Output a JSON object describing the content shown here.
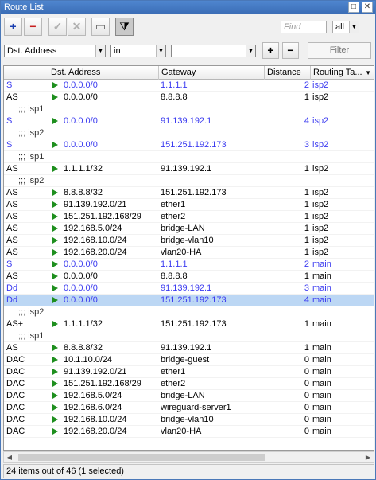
{
  "window": {
    "title": "Route List"
  },
  "toolbar": {
    "add_label": "+",
    "remove_label": "−",
    "enable_label": "✓",
    "disable_label": "✕",
    "comment_label": "▭",
    "filter_label": "⧩",
    "find_placeholder": "Find",
    "scope_value": "all"
  },
  "filter": {
    "field_value": "Dst. Address",
    "operator_value": "in",
    "value": "",
    "add_label": "+",
    "remove_label": "−",
    "button_label": "Filter"
  },
  "table": {
    "columns": [
      "",
      "Dst. Address",
      "Gateway",
      "Distance",
      "Routing Ta..."
    ],
    "rows": [
      {
        "flags": "S",
        "dst": "0.0.0.0/0",
        "gateway": "1.1.1.1",
        "distance": "2",
        "table": "isp2",
        "style": "blue"
      },
      {
        "flags": "AS",
        "dst": "0.0.0.0/0",
        "gateway": "8.8.8.8",
        "distance": "1",
        "table": "isp2",
        "style": "normal"
      },
      {
        "comment": ";;; isp1"
      },
      {
        "flags": "S",
        "dst": "0.0.0.0/0",
        "gateway": "91.139.192.1",
        "distance": "4",
        "table": "isp2",
        "style": "blue"
      },
      {
        "comment": ";;; isp2"
      },
      {
        "flags": "S",
        "dst": "0.0.0.0/0",
        "gateway": "151.251.192.173",
        "distance": "3",
        "table": "isp2",
        "style": "blue"
      },
      {
        "comment": ";;; isp1"
      },
      {
        "flags": "AS",
        "dst": "1.1.1.1/32",
        "gateway": "91.139.192.1",
        "distance": "1",
        "table": "isp2",
        "style": "normal"
      },
      {
        "comment": ";;; isp2"
      },
      {
        "flags": "AS",
        "dst": "8.8.8.8/32",
        "gateway": "151.251.192.173",
        "distance": "1",
        "table": "isp2",
        "style": "normal"
      },
      {
        "flags": "AS",
        "dst": "91.139.192.0/21",
        "gateway": "ether1",
        "distance": "1",
        "table": "isp2",
        "style": "normal"
      },
      {
        "flags": "AS",
        "dst": "151.251.192.168/29",
        "gateway": "ether2",
        "distance": "1",
        "table": "isp2",
        "style": "normal"
      },
      {
        "flags": "AS",
        "dst": "192.168.5.0/24",
        "gateway": "bridge-LAN",
        "distance": "1",
        "table": "isp2",
        "style": "normal"
      },
      {
        "flags": "AS",
        "dst": "192.168.10.0/24",
        "gateway": "bridge-vlan10",
        "distance": "1",
        "table": "isp2",
        "style": "normal"
      },
      {
        "flags": "AS",
        "dst": "192.168.20.0/24",
        "gateway": "vlan20-HA",
        "distance": "1",
        "table": "isp2",
        "style": "normal"
      },
      {
        "flags": "S",
        "dst": "0.0.0.0/0",
        "gateway": "1.1.1.1",
        "distance": "2",
        "table": "main",
        "style": "blue"
      },
      {
        "flags": "AS",
        "dst": "0.0.0.0/0",
        "gateway": "8.8.8.8",
        "distance": "1",
        "table": "main",
        "style": "normal"
      },
      {
        "flags": "Dd",
        "dst": "0.0.0.0/0",
        "gateway": "91.139.192.1",
        "distance": "3",
        "table": "main",
        "style": "blue"
      },
      {
        "flags": "Dd",
        "dst": "0.0.0.0/0",
        "gateway": "151.251.192.173",
        "distance": "4",
        "table": "main",
        "style": "selected"
      },
      {
        "comment": ";;; isp2"
      },
      {
        "flags": "AS+",
        "dst": "1.1.1.1/32",
        "gateway": "151.251.192.173",
        "distance": "1",
        "table": "main",
        "style": "normal"
      },
      {
        "comment": ";;; isp1"
      },
      {
        "flags": "AS",
        "dst": "8.8.8.8/32",
        "gateway": "91.139.192.1",
        "distance": "1",
        "table": "main",
        "style": "normal"
      },
      {
        "flags": "DAC",
        "dst": "10.1.10.0/24",
        "gateway": "bridge-guest",
        "distance": "0",
        "table": "main",
        "style": "normal"
      },
      {
        "flags": "DAC",
        "dst": "91.139.192.0/21",
        "gateway": "ether1",
        "distance": "0",
        "table": "main",
        "style": "normal"
      },
      {
        "flags": "DAC",
        "dst": "151.251.192.168/29",
        "gateway": "ether2",
        "distance": "0",
        "table": "main",
        "style": "normal"
      },
      {
        "flags": "DAC",
        "dst": "192.168.5.0/24",
        "gateway": "bridge-LAN",
        "distance": "0",
        "table": "main",
        "style": "normal"
      },
      {
        "flags": "DAC",
        "dst": "192.168.6.0/24",
        "gateway": "wireguard-server1",
        "distance": "0",
        "table": "main",
        "style": "normal"
      },
      {
        "flags": "DAC",
        "dst": "192.168.10.0/24",
        "gateway": "bridge-vlan10",
        "distance": "0",
        "table": "main",
        "style": "normal"
      },
      {
        "flags": "DAC",
        "dst": "192.168.20.0/24",
        "gateway": "vlan20-HA",
        "distance": "0",
        "table": "main",
        "style": "normal"
      }
    ]
  },
  "status": {
    "text": "24 items out of 46 (1 selected)"
  },
  "colors": {
    "accent_blue": "#3a3af0",
    "selection": "#bcd7f4",
    "arrow_green": "#1e8f1e",
    "title_bar": "#3a6cb5"
  }
}
